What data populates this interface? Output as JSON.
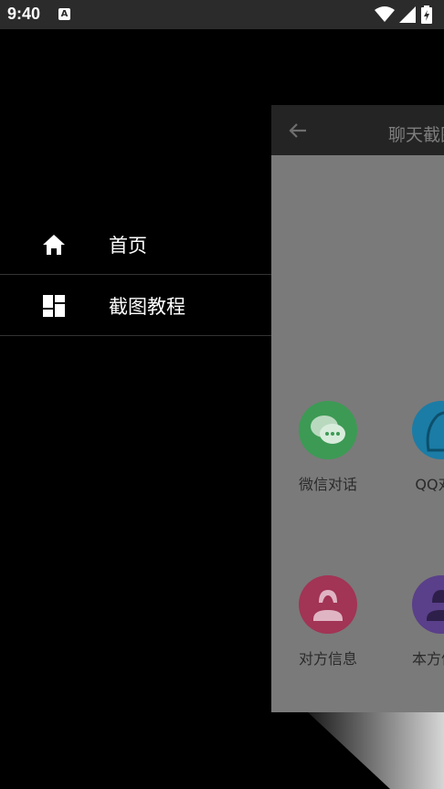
{
  "status_bar": {
    "time": "9:40",
    "notification_icon": "a-letter-icon",
    "icons": [
      "wifi-icon",
      "signal-icon",
      "battery-charging-icon"
    ]
  },
  "drawer": {
    "items": [
      {
        "label": "首页",
        "icon": "home-icon"
      },
      {
        "label": "截图教程",
        "icon": "dashboard-icon"
      }
    ]
  },
  "background_app": {
    "title": "聊天截图",
    "back_icon": "arrow-left-icon",
    "tiles": [
      {
        "label": "微信对话",
        "color": "#3c9a54",
        "icon": "chat-bubbles-icon"
      },
      {
        "label": "QQ对话",
        "color": "#1b7ca6",
        "icon": "penguin-icon"
      },
      {
        "label": "对方信息",
        "color": "#a23455",
        "icon": "person-icon"
      },
      {
        "label": "本方信息",
        "color": "#5a3f8a",
        "icon": "person-icon"
      }
    ]
  }
}
